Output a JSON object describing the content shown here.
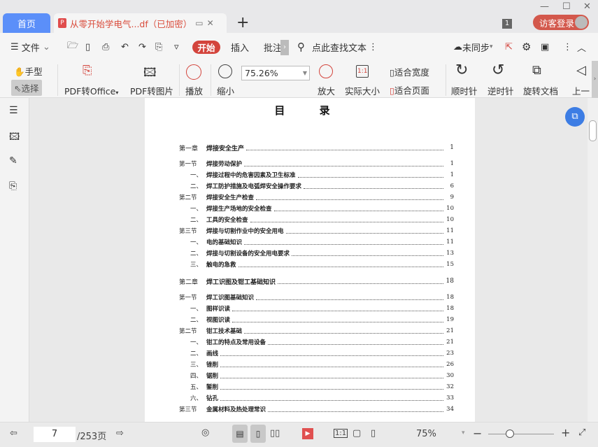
{
  "tabs": {
    "home": "首页",
    "doc_title": "从零开始学电气...df（已加密）",
    "window_count": "1",
    "login": "访客登录"
  },
  "toolbar": {
    "file": "文件",
    "start": "开始",
    "insert": "插入",
    "annotate": "批注",
    "search_placeholder": "点此查找文本",
    "sync": "未同步"
  },
  "ribbon": {
    "hand": "手型",
    "select": "选择",
    "pdf_to_office": "PDF转Office",
    "pdf_to_image": "PDF转图片",
    "play": "播放",
    "zoom_out": "缩小",
    "zoom_value": "75.26%",
    "zoom_in": "放大",
    "actual_size": "实际大小",
    "fit_width": "适合宽度",
    "fit_page": "适合页面",
    "clockwise": "顺时针",
    "counterclockwise": "逆时针",
    "rotate_doc": "旋转文档",
    "prev": "上一"
  },
  "document": {
    "title": "目 录",
    "entries": [
      {
        "level": "ch",
        "num": "第一章",
        "label": "焊接安全生产",
        "page": "1"
      },
      {
        "level": "sec",
        "num": "第一节",
        "label": "焊接劳动保护",
        "page": "1"
      },
      {
        "level": "sub",
        "num": "一、",
        "label": "焊接过程中的危害因素及卫生标准",
        "page": "1"
      },
      {
        "level": "sub",
        "num": "二、",
        "label": "焊工防护措施及电弧焊安全操作要求",
        "page": "6"
      },
      {
        "level": "sec",
        "num": "第二节",
        "label": "焊接安全生产检查",
        "page": "9"
      },
      {
        "level": "sub",
        "num": "一、",
        "label": "焊接生产场地的安全检查",
        "page": "10"
      },
      {
        "level": "sub",
        "num": "二、",
        "label": "工具的安全检查",
        "page": "10"
      },
      {
        "level": "sec",
        "num": "第三节",
        "label": "焊接与切割作业中的安全用电",
        "page": "11"
      },
      {
        "level": "sub",
        "num": "一、",
        "label": "电的基础知识",
        "page": "11"
      },
      {
        "level": "sub",
        "num": "二、",
        "label": "焊接与切割设备的安全用电要求",
        "page": "13"
      },
      {
        "level": "sub",
        "num": "三、",
        "label": "触电的急救",
        "page": "15"
      },
      {
        "level": "ch",
        "num": "第二章",
        "label": "焊工识图及钳工基础知识",
        "page": "18"
      },
      {
        "level": "sec",
        "num": "第一节",
        "label": "焊工识图基础知识",
        "page": "18"
      },
      {
        "level": "sub",
        "num": "一、",
        "label": "图样识读",
        "page": "18"
      },
      {
        "level": "sub",
        "num": "二、",
        "label": "视图识读",
        "page": "19"
      },
      {
        "level": "sec",
        "num": "第二节",
        "label": "钳工技术基础",
        "page": "21"
      },
      {
        "level": "sub",
        "num": "一、",
        "label": "钳工的特点及常用设备",
        "page": "21"
      },
      {
        "level": "sub",
        "num": "二、",
        "label": "画线",
        "page": "23"
      },
      {
        "level": "sub",
        "num": "三、",
        "label": "锉削",
        "page": "26"
      },
      {
        "level": "sub",
        "num": "四、",
        "label": "锯削",
        "page": "30"
      },
      {
        "level": "sub",
        "num": "五、",
        "label": "錾削",
        "page": "32"
      },
      {
        "level": "sub",
        "num": "六、",
        "label": "钻孔",
        "page": "33"
      },
      {
        "level": "sec",
        "num": "第三节",
        "label": "金属材料及热处理常识",
        "page": "34"
      }
    ]
  },
  "statusbar": {
    "current_page": "7",
    "total_pages": "/253页",
    "zoom": "75%",
    "zoom_slider_percent": 33
  }
}
